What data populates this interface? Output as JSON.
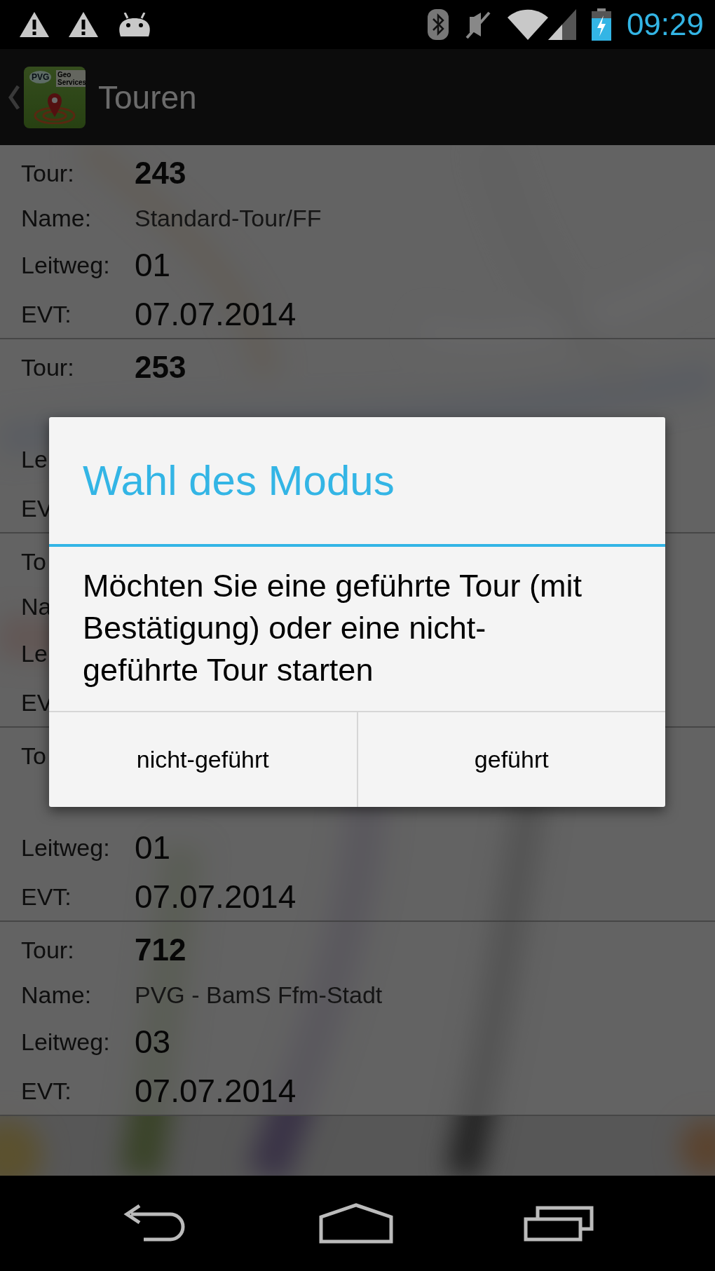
{
  "status_bar": {
    "time": "09:29"
  },
  "app_bar": {
    "logo": {
      "brand": "PVG",
      "subtitle_lines": [
        "Geo",
        "Services"
      ]
    },
    "title": "Touren"
  },
  "tours": [
    {
      "fields": [
        {
          "kind": "tour",
          "label": "Tour:",
          "value": "243"
        },
        {
          "kind": "name",
          "label": "Name:",
          "value": "Standard-Tour/FF"
        },
        {
          "kind": "leitweg",
          "label": "Leitweg:",
          "value": "01"
        },
        {
          "kind": "evt",
          "label": "EVT:",
          "value": "07.07.2014"
        }
      ]
    },
    {
      "fields": [
        {
          "kind": "tour",
          "label": "Tour:",
          "value": "253"
        },
        {
          "kind": "name"
        },
        {
          "kind": "leitweg",
          "label": "Le"
        },
        {
          "kind": "evt",
          "label": "EV"
        }
      ]
    },
    {
      "fields": [
        {
          "kind": "tour",
          "label": "To"
        },
        {
          "kind": "name",
          "label": "Na"
        },
        {
          "kind": "leitweg",
          "label": "Le"
        },
        {
          "kind": "evt",
          "label": "EV"
        }
      ]
    },
    {
      "fields": [
        {
          "kind": "tour",
          "label": "To"
        },
        {
          "kind": "name"
        },
        {
          "kind": "leitweg",
          "label": "Leitweg:",
          "value": "01"
        },
        {
          "kind": "evt",
          "label": "EVT:",
          "value": "07.07.2014"
        }
      ]
    },
    {
      "fields": [
        {
          "kind": "tour",
          "label": "Tour:",
          "value": "712"
        },
        {
          "kind": "name",
          "label": "Name:",
          "value": "PVG - BamS Ffm-Stadt"
        },
        {
          "kind": "leitweg",
          "label": "Leitweg:",
          "value": "03"
        },
        {
          "kind": "evt",
          "label": "EVT:",
          "value": "07.07.2014"
        }
      ]
    }
  ],
  "dialog": {
    "title": "Wahl des Modus",
    "message": "Möchten Sie eine geführte Tour (mit Bestätigung) oder eine nicht-geführte Tour starten",
    "buttons": [
      "nicht-geführt",
      "geführt"
    ]
  }
}
